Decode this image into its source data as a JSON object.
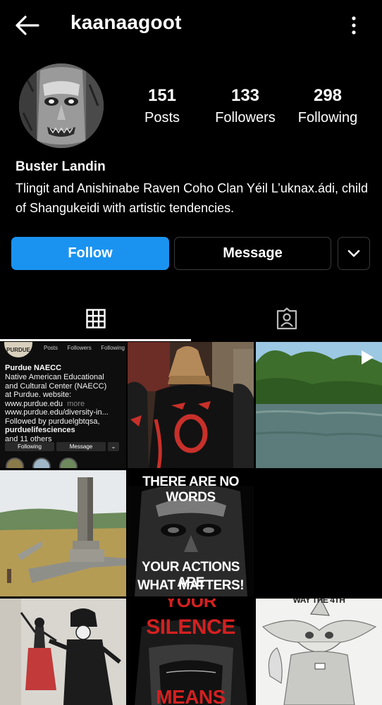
{
  "header": {
    "username": "kaanaagoot"
  },
  "profile": {
    "stats": [
      {
        "value": "151",
        "label": "Posts"
      },
      {
        "value": "133",
        "label": "Followers"
      },
      {
        "value": "298",
        "label": "Following"
      }
    ],
    "full_name": "Buster Landin",
    "bio": "Tlingit and Anishinabe Raven Coho Clan Yéil  L’uknax.ádi, child of Shangukeidi with artistic tendencies."
  },
  "actions": {
    "follow_label": "Follow",
    "message_label": "Message"
  },
  "colors": {
    "accent": "#1a93f0",
    "background": "#000000"
  },
  "grid_posts": {
    "post1": {
      "logo_text": "PURDUE",
      "stat_labels": [
        "Posts",
        "Followers",
        "Following"
      ],
      "name": "Purdue NAECC",
      "bio_lines": [
        "Native American Educational",
        "and Cultural Center (NAECC)",
        "at Purdue. website:",
        "www.purdue.edu",
        "www.purdue.edu/diversity-in...",
        "Followed by purduelgbtqsa,",
        "purduelifesciences",
        "and 11 others"
      ],
      "more_label": "more",
      "following_label": "Following",
      "message_label": "Message"
    },
    "post5": {
      "line1": "THERE ARE NO WORDS",
      "line2": "YOUR ACTIONS ARE",
      "line3": "WHAT MATTERS!"
    },
    "post8": {
      "line1": "YOUR",
      "line2": "SILENCE",
      "line3": "MEANS"
    },
    "post9": {
      "line1": "WAY THE 4TH"
    }
  }
}
